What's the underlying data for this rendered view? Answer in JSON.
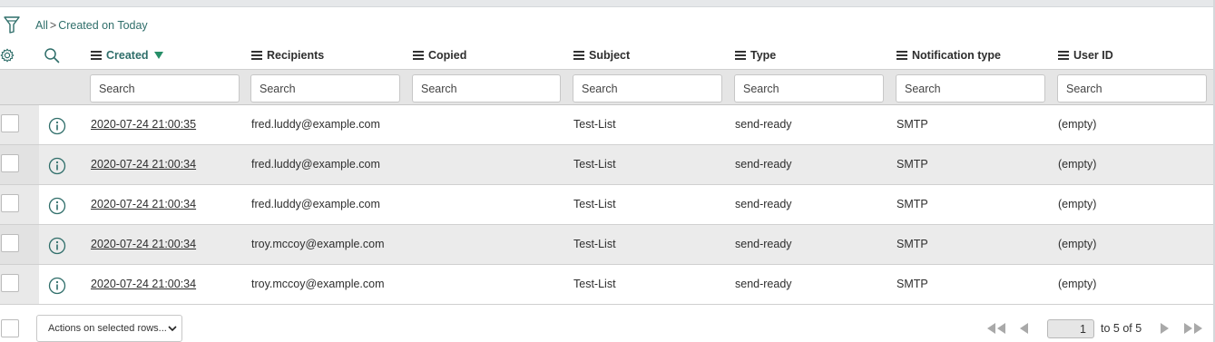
{
  "breadcrumb": {
    "root": "All",
    "separator": ">",
    "filter": "Created on Today"
  },
  "columns": [
    {
      "key": "created",
      "label": "Created",
      "sorted": true,
      "sort_dir": "desc"
    },
    {
      "key": "recipients",
      "label": "Recipients"
    },
    {
      "key": "copied",
      "label": "Copied"
    },
    {
      "key": "subject",
      "label": "Subject"
    },
    {
      "key": "type",
      "label": "Type"
    },
    {
      "key": "notification_type",
      "label": "Notification type"
    },
    {
      "key": "user_id",
      "label": "User ID"
    }
  ],
  "search_placeholder": "Search",
  "rows": [
    {
      "created": "2020-07-24 21:00:35",
      "recipients": "fred.luddy@example.com",
      "copied": "",
      "subject": "Test-List",
      "type": "send-ready",
      "notification_type": "SMTP",
      "user_id": "(empty)"
    },
    {
      "created": "2020-07-24 21:00:34",
      "recipients": "fred.luddy@example.com",
      "copied": "",
      "subject": "Test-List",
      "type": "send-ready",
      "notification_type": "SMTP",
      "user_id": "(empty)"
    },
    {
      "created": "2020-07-24 21:00:34",
      "recipients": "fred.luddy@example.com",
      "copied": "",
      "subject": "Test-List",
      "type": "send-ready",
      "notification_type": "SMTP",
      "user_id": "(empty)"
    },
    {
      "created": "2020-07-24 21:00:34",
      "recipients": "troy.mccoy@example.com",
      "copied": "",
      "subject": "Test-List",
      "type": "send-ready",
      "notification_type": "SMTP",
      "user_id": "(empty)"
    },
    {
      "created": "2020-07-24 21:00:34",
      "recipients": "troy.mccoy@example.com",
      "copied": "",
      "subject": "Test-List",
      "type": "send-ready",
      "notification_type": "SMTP",
      "user_id": "(empty)"
    }
  ],
  "footer": {
    "actions_label": "Actions on selected rows...",
    "page_value": "1",
    "range_text": "to 5 of 5"
  },
  "icons": {
    "filter": "filter-funnel-icon",
    "settings": "gear-icon",
    "search": "search-icon",
    "info": "info-circle-icon",
    "sort": "sort-down-arrow-icon",
    "pager": [
      "first-page-icon",
      "prev-page-icon",
      "next-page-icon",
      "last-page-icon"
    ]
  },
  "colors": {
    "accent": "#2f6e6a",
    "sort_arrow": "#278e68",
    "row_alt": "#ebebeb",
    "search_row": "#e5e5e5"
  }
}
